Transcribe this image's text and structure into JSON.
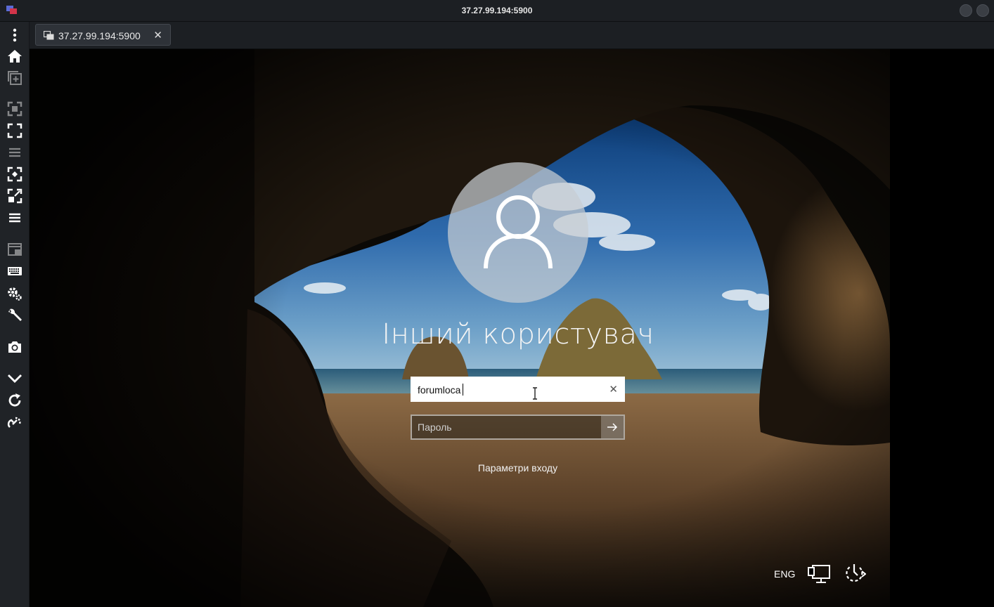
{
  "window": {
    "title": "37.27.99.194:5900",
    "app_icon": "vnc-viewer-icon"
  },
  "tab": {
    "label": "37.27.99.194:5900",
    "icon": "remote-screens-icon",
    "close": "✕"
  },
  "toolbar": {
    "items": [
      {
        "icon": "more-vertical-icon"
      },
      {
        "icon": "home-icon"
      },
      {
        "icon": "new-connection-icon"
      },
      {
        "icon": "fit-to-window-icon"
      },
      {
        "icon": "fullscreen-icon"
      },
      {
        "icon": "menu-disabled-icon"
      },
      {
        "icon": "scale-icon"
      },
      {
        "icon": "resize-remote-icon"
      },
      {
        "icon": "menu-icon"
      },
      {
        "icon": "view-only-icon"
      },
      {
        "icon": "keyboard-icon"
      },
      {
        "icon": "settings-icon"
      },
      {
        "icon": "tools-icon"
      },
      {
        "icon": "screenshot-icon"
      },
      {
        "icon": "collapse-icon"
      },
      {
        "icon": "refresh-icon"
      },
      {
        "icon": "disconnect-icon"
      }
    ]
  },
  "login": {
    "user_name": "Інший користувач",
    "username_value": "forumloca",
    "clear_symbol": "✕",
    "password_placeholder": "Пароль",
    "signin_options": "Параметри входу"
  },
  "tray": {
    "language": "ENG",
    "network_icon": "network-icon",
    "power_icon": "ease-of-access-icon"
  },
  "colors": {
    "titlebar_bg": "#1c1f23",
    "toolbar_bg": "#202327",
    "tab_bg": "#2e3238"
  }
}
